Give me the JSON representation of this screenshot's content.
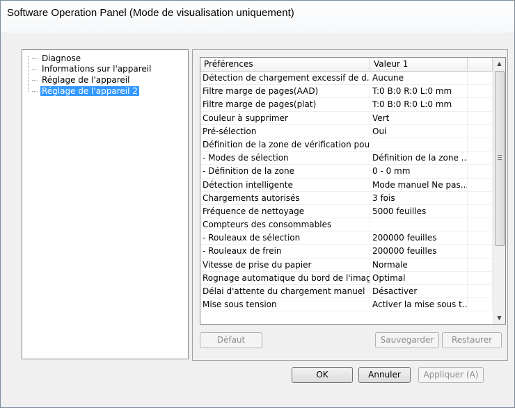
{
  "window": {
    "title": "Software Operation Panel (Mode de visualisation uniquement)"
  },
  "tree": {
    "items": [
      {
        "label": "Diagnose",
        "selected": false
      },
      {
        "label": "Informations sur l'appareil",
        "selected": false
      },
      {
        "label": "Réglage de l'appareil",
        "selected": false
      },
      {
        "label": "Réglage de l'appareil 2",
        "selected": true
      }
    ]
  },
  "grid": {
    "headers": [
      "Préférences",
      "Valeur 1",
      ""
    ],
    "rows": [
      {
        "pref": "Détection de chargement excessif de d...",
        "value": "Aucune"
      },
      {
        "pref": "Filtre marge de pages(AAD)",
        "value": "T:0  B:0  R:0  L:0 mm"
      },
      {
        "pref": "Filtre marge de pages(plat)",
        "value": "T:0  B:0  R:0  L:0 mm"
      },
      {
        "pref": "Couleur à supprimer",
        "value": "Vert"
      },
      {
        "pref": "Pré-sélection",
        "value": "Oui"
      },
      {
        "pref": "Définition de la zone de vérification pour...",
        "value": ""
      },
      {
        "pref": " - Modes de sélection",
        "value": "Définition de la zone ..."
      },
      {
        "pref": " - Définition de la zone",
        "value": "0 - 0 mm"
      },
      {
        "pref": "Détection intelligente",
        "value": "Mode manuel  Ne pas..."
      },
      {
        "pref": "Chargements autorisés",
        "value": "3 fois"
      },
      {
        "pref": "Fréquence de nettoyage",
        "value": "5000 feuilles"
      },
      {
        "pref": "Compteurs des consommables",
        "value": ""
      },
      {
        "pref": "- Rouleaux de sélection",
        "value": "200000 feuilles"
      },
      {
        "pref": " - Rouleaux de frein",
        "value": "200000 feuilles"
      },
      {
        "pref": "Vitesse de prise du papier",
        "value": "Normale"
      },
      {
        "pref": "Rognage automatique du bord de l'image",
        "value": "Optimal"
      },
      {
        "pref": "Délai d'attente du chargement manuel",
        "value": "Désactiver"
      },
      {
        "pref": "Mise sous tension",
        "value": "Activer la mise sous t..."
      }
    ]
  },
  "buttons": {
    "default": "Défaut",
    "save": "Sauvegarder",
    "restore": "Restaurer",
    "ok": "OK",
    "cancel": "Annuler",
    "apply": "Appliquer (A)"
  }
}
